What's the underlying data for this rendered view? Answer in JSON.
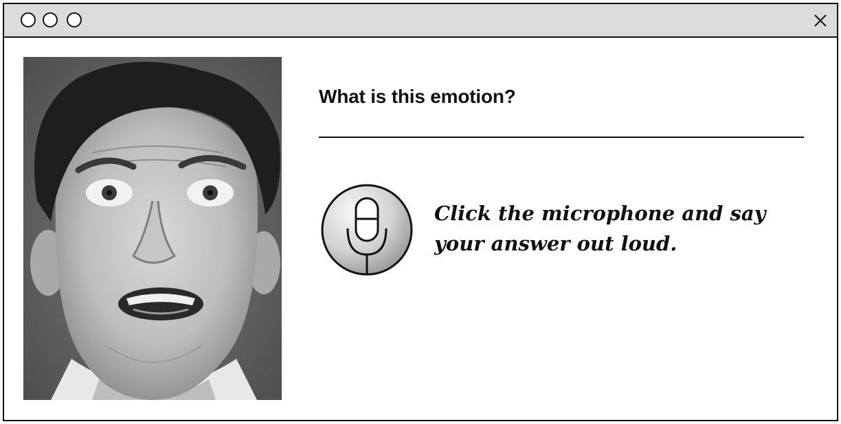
{
  "window": {
    "traffic_lights": [
      "circle-button",
      "circle-button",
      "circle-button"
    ],
    "close_icon": "close-x-icon"
  },
  "photo": {
    "icon": "face-photo",
    "grayscale": true
  },
  "question": {
    "text": "What is this emotion?"
  },
  "answer": {
    "value": ""
  },
  "mic": {
    "icon": "microphone-icon"
  },
  "instruction": {
    "line1": "Click the microphone and say",
    "line2": "your answer out loud."
  }
}
